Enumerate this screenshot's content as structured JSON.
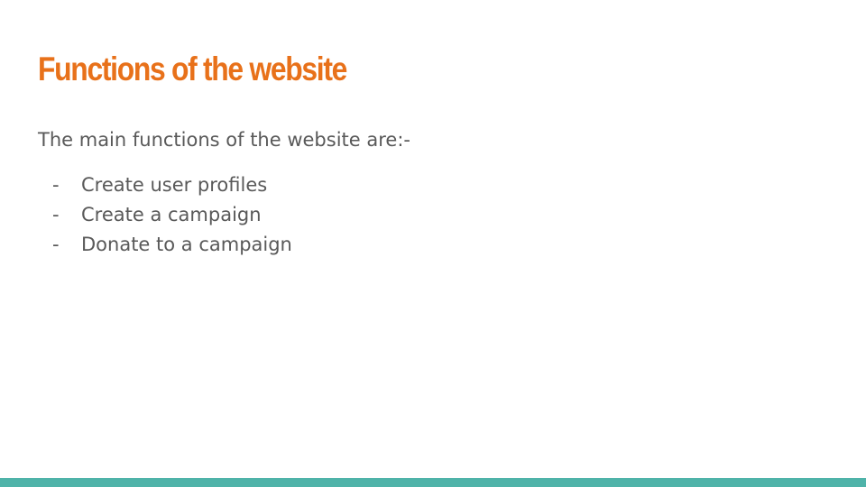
{
  "slide": {
    "title": "Functions of the website",
    "intro": "The main functions of the website are:-",
    "bullets": [
      {
        "marker": "-",
        "text": "Create user profiles"
      },
      {
        "marker": "-",
        "text": "Create a campaign"
      },
      {
        "marker": "-",
        "text": "Donate to a campaign"
      }
    ]
  },
  "colors": {
    "title": "#e8711a",
    "body_text": "#595959",
    "accent_bar": "#4fb3a9",
    "background": "#ffffff"
  }
}
